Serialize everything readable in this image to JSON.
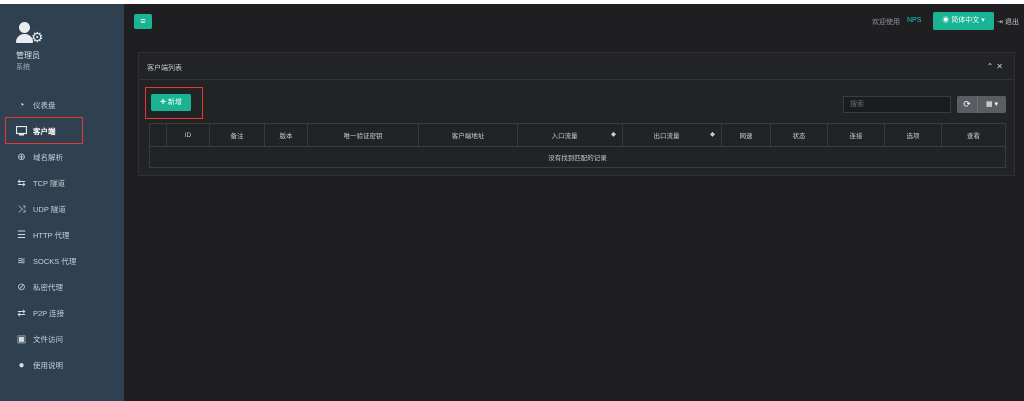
{
  "sidebar": {
    "profile": {
      "name": "管理员",
      "role": "系统"
    },
    "items": [
      {
        "icon": "dashboard-icon",
        "label": "仪表盘",
        "active": false
      },
      {
        "icon": "monitor-icon",
        "label": "客户端",
        "active": true
      },
      {
        "icon": "globe-icon",
        "label": "域名解析",
        "active": false
      },
      {
        "icon": "tcp-arrows-icon",
        "label": "TCP 隧道",
        "active": false
      },
      {
        "icon": "shuffle-icon",
        "label": "UDP 隧道",
        "active": false
      },
      {
        "icon": "list-icon",
        "label": "HTTP 代理",
        "active": false
      },
      {
        "icon": "layers-icon",
        "label": "SOCKS 代理",
        "active": false
      },
      {
        "icon": "eye-slash-icon",
        "label": "私密代理",
        "active": false
      },
      {
        "icon": "exchange-icon",
        "label": "P2P 连接",
        "active": false
      },
      {
        "icon": "briefcase-icon",
        "label": "文件访问",
        "active": false
      },
      {
        "icon": "lightbulb-icon",
        "label": "使用说明",
        "active": false
      }
    ]
  },
  "topbar": {
    "menu_icon": "≡",
    "welcome": "欢迎使用",
    "brand": "NPS",
    "language": "简体中文",
    "logout": "退出"
  },
  "panel": {
    "title": "客户端列表",
    "add_label": "新增",
    "search_placeholder": "搜索",
    "columns": [
      "",
      "ID",
      "备注",
      "版本",
      "唯一验证密钥",
      "客户端地址",
      "入口流量",
      "出口流量",
      "网速",
      "状态",
      "连接",
      "选项",
      "查看"
    ],
    "empty_message": "没有找到匹配的记录"
  },
  "colors": {
    "accent": "#1ab394",
    "sidebar_bg": "#2f4050",
    "highlight": "#e53935"
  }
}
